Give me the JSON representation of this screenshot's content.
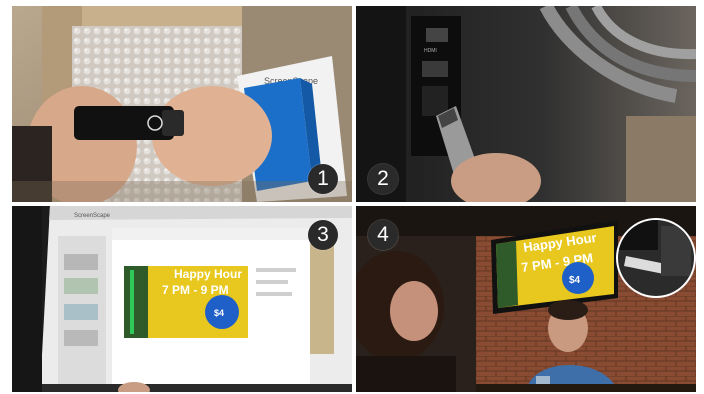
{
  "steps": [
    {
      "number": "1",
      "scene": "usb-stick-unboxing"
    },
    {
      "number": "2",
      "scene": "usb-plugged-into-tv-hdmi"
    },
    {
      "number": "3",
      "scene": "monitor-editor-preview"
    },
    {
      "number": "4",
      "scene": "restaurant-digital-signage"
    }
  ],
  "box_brand": "ScreenScape",
  "tv_port_label": "HDMI",
  "editor": {
    "app_name": "ScreenScape"
  },
  "sign": {
    "title": "Happy Hour",
    "time": "7 PM - 9 PM",
    "price": "$4"
  },
  "colors": {
    "step_badge": "#2a2a2a",
    "sign_yellow": "#e8c81e",
    "sign_blue": "#1e5fc8"
  }
}
